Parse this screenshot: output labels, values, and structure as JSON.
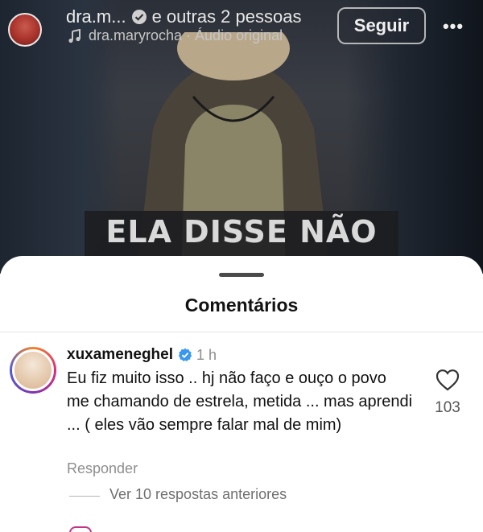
{
  "header": {
    "author": "dra.m...",
    "others": "e outras 2 pessoas",
    "audio": "dra.maryrocha · Áudio original",
    "follow_label": "Seguir",
    "more_label": "•••"
  },
  "video": {
    "caption": "ELA DISSE NÃO"
  },
  "sheet": {
    "title": "Comentários"
  },
  "comment": {
    "username": "xuxameneghel",
    "time": "1 h",
    "text": "Eu fiz muito isso .. hj não faço e  ouço o povo me chamando de estrela, metida ... mas aprendi ... ( eles vão sempre falar mal de mim)",
    "likes": "103",
    "reply_label": "Responder",
    "view_replies_label": "Ver 10 respostas anteriores"
  },
  "colors": {
    "verified": "#3897f0",
    "muted_text": "#8e8e8e"
  }
}
